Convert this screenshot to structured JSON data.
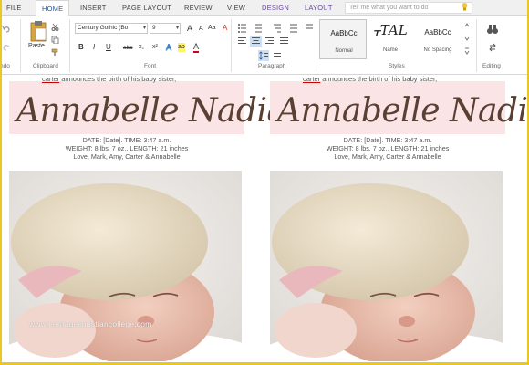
{
  "tabs": {
    "file": "FILE",
    "home": "HOME",
    "insert": "INSERT",
    "page_layout": "PAGE LAYOUT",
    "review": "REVIEW",
    "view": "VIEW",
    "design": "DESIGN",
    "layout": "LAYOUT"
  },
  "tell_me": {
    "placeholder": "Tell me what you want to do"
  },
  "ribbon": {
    "undo_label": "ndo",
    "clipboard": {
      "paste_label": "Paste",
      "group_label": "Clipboard"
    },
    "font": {
      "family": "Century Gothic (Bo",
      "size": "9",
      "bold": "B",
      "italic": "I",
      "underline": "U",
      "strike": "abc",
      "subscript": "x₂",
      "superscript": "x²",
      "grow": "A",
      "shrink": "A",
      "case": "Aa",
      "clear": "A",
      "highlight": "ab",
      "color": "A",
      "group_label": "Font"
    },
    "paragraph": {
      "group_label": "Paragraph"
    },
    "styles": {
      "items": [
        {
          "sample": "AaBbCc",
          "name": "Normal"
        },
        {
          "sample": "ᚁTAL",
          "name": "Name"
        },
        {
          "sample": "AaBbCc",
          "name": "No Spacing"
        }
      ],
      "group_label": "Styles"
    },
    "editing": {
      "group_label": "Editing"
    }
  },
  "document": {
    "columns": [
      {
        "intro_name": "carter",
        "intro_rest": " announces the birth of his baby sister,",
        "baby_name": "Annabelle Nadia",
        "details_line1": "DATE: [Date]. TIME: 3:47 a.m.",
        "details_line2": "WEIGHT: 8 lbs. 7 oz.. LENGTH: 21 inches",
        "details_line3": "Love, Mark, Amy, Carter & Annabelle"
      },
      {
        "intro_name": "carter",
        "intro_rest": " announces the birth of his baby sister,",
        "baby_name": "Annabelle Nadia",
        "details_line1": "DATE: [Date]. TIME: 3:47 a.m.",
        "details_line2": "WEIGHT: 8 lbs. 7 oz.. LENGTH: 21 inches",
        "details_line3": "Love, Mark, Amy, Carter & Annabelle"
      }
    ],
    "watermark": "www.heritagechristiancollege.com"
  },
  "colors": {
    "frame": "#e8c821",
    "name_band": "#fbe4e6",
    "name_text": "#5a3f33",
    "tab_accent": "#2b579a"
  }
}
